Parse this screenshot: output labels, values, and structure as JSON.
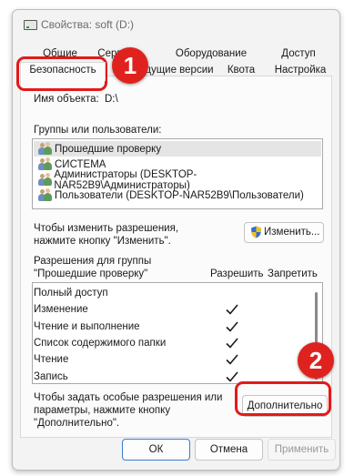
{
  "window": {
    "title": "Свойства: soft (D:)"
  },
  "tabs_row1": [
    "Общие",
    "Сервис",
    "Оборудование",
    "Доступ"
  ],
  "tabs_row2": [
    "Безопасность",
    "Предыдущие версии",
    "Квота",
    "Настройка"
  ],
  "active_tab": "Безопасность",
  "object": {
    "label": "Имя объекта:",
    "value": "D:\\"
  },
  "groups": {
    "label": "Группы или пользователи:",
    "items": [
      "Прошедшие проверку",
      "СИСТЕМА",
      "Администраторы (DESKTOP-NAR52B9\\Администраторы)",
      "Пользователи (DESKTOP-NAR52B9\\Пользователи)"
    ],
    "selected_index": 0
  },
  "change_hint": {
    "line1": "Чтобы изменить разрешения,",
    "line2": "нажмите кнопку \"Изменить\"."
  },
  "change_button": "Изменить...",
  "permissions": {
    "label_line1": "Разрешения для группы",
    "label_line2": "\"Прошедшие проверку\"",
    "col_allow": "Разрешить",
    "col_deny": "Запретить",
    "rows": [
      {
        "name": "Полный доступ",
        "allow": false,
        "deny": false
      },
      {
        "name": "Изменение",
        "allow": true,
        "deny": false
      },
      {
        "name": "Чтение и выполнение",
        "allow": true,
        "deny": false
      },
      {
        "name": "Список содержимого папки",
        "allow": true,
        "deny": false
      },
      {
        "name": "Чтение",
        "allow": true,
        "deny": false
      },
      {
        "name": "Запись",
        "allow": true,
        "deny": false
      }
    ]
  },
  "advanced_hint": {
    "line1": "Чтобы задать особые разрешения или",
    "line2": "параметры, нажмите кнопку",
    "line3": "\"Дополнительно\"."
  },
  "advanced_button": "Дополнительно",
  "footer": {
    "ok": "ОК",
    "cancel": "Отмена",
    "apply": "Применить"
  },
  "callouts": {
    "badge1": "1",
    "badge2": "2"
  },
  "colors": {
    "callout": "#e21a1a",
    "selection": "#e5e5e5",
    "shield_blue": "#2f6fd1",
    "shield_yellow": "#f2c31b"
  }
}
